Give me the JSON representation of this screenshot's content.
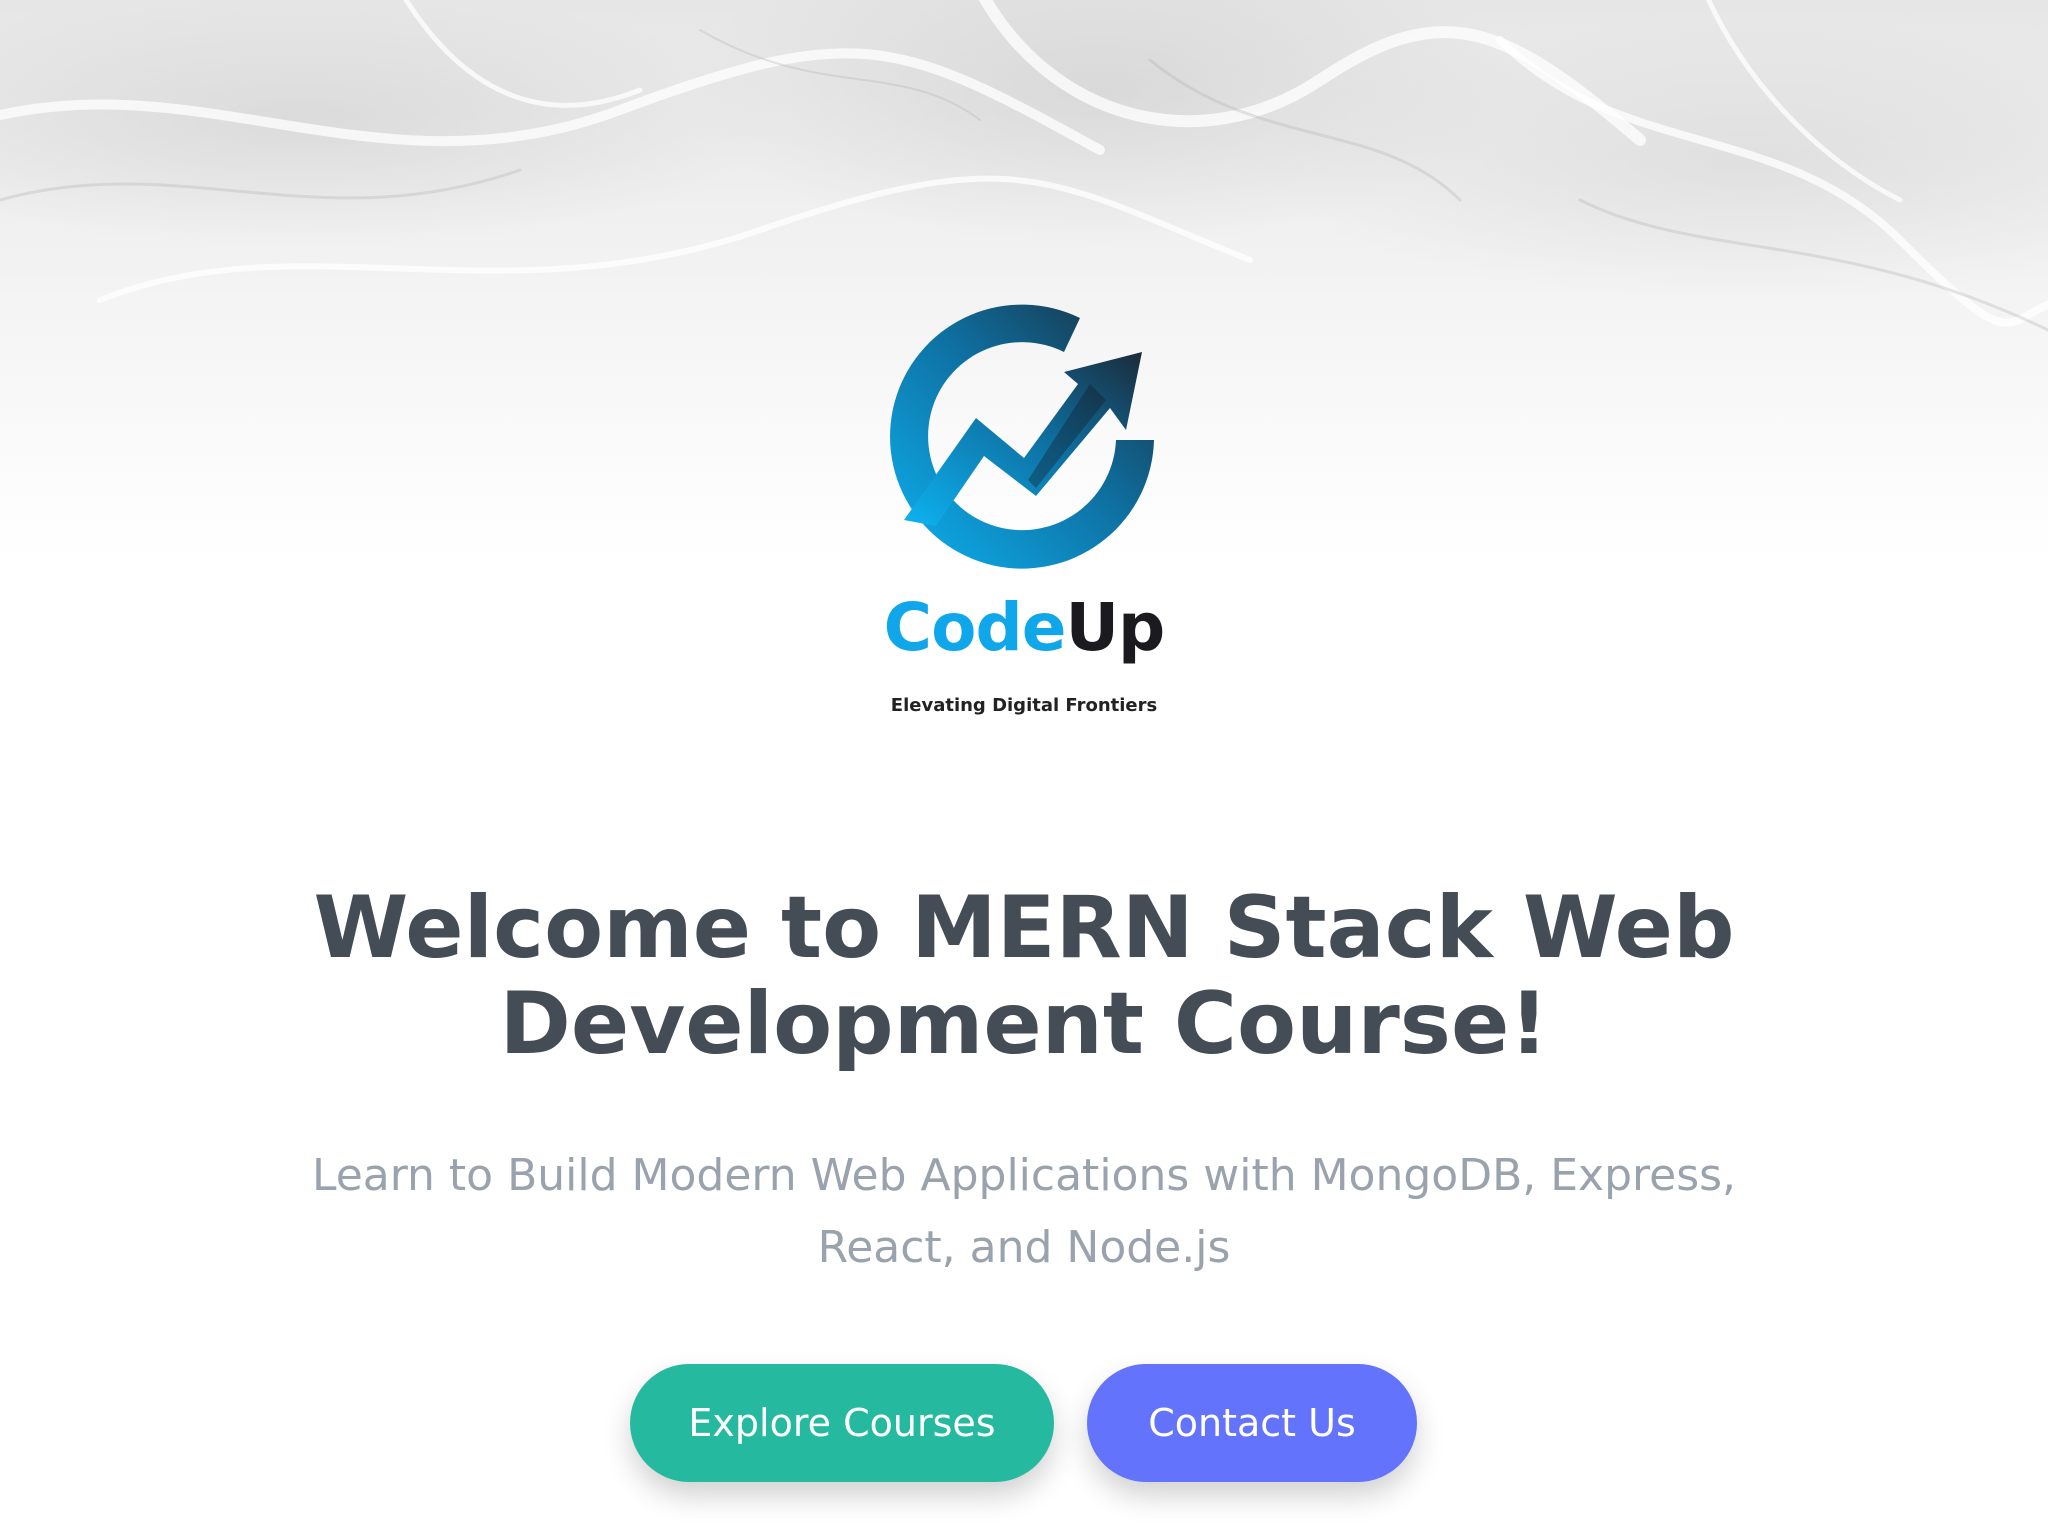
{
  "brand": {
    "name_part1": "Code",
    "name_part2": "Up",
    "tagline": "Elevating Digital Frontiers",
    "logo_icon": "growth-arrow-circle-icon"
  },
  "hero": {
    "title": "Welcome to MERN Stack Web Development Course!",
    "subtitle": "Learn to Build Modern Web Applications with MongoDB, Express, React, and Node.js"
  },
  "actions": {
    "explore_label": "Explore Courses",
    "contact_label": "Contact Us"
  },
  "colors": {
    "explore_button": "#25ba9f",
    "contact_button": "#6373fb",
    "title_text": "#444c56",
    "subtitle_text": "#9aa2ad",
    "brand_blue": "#10a7ea",
    "brand_dark": "#1b1b1f"
  }
}
